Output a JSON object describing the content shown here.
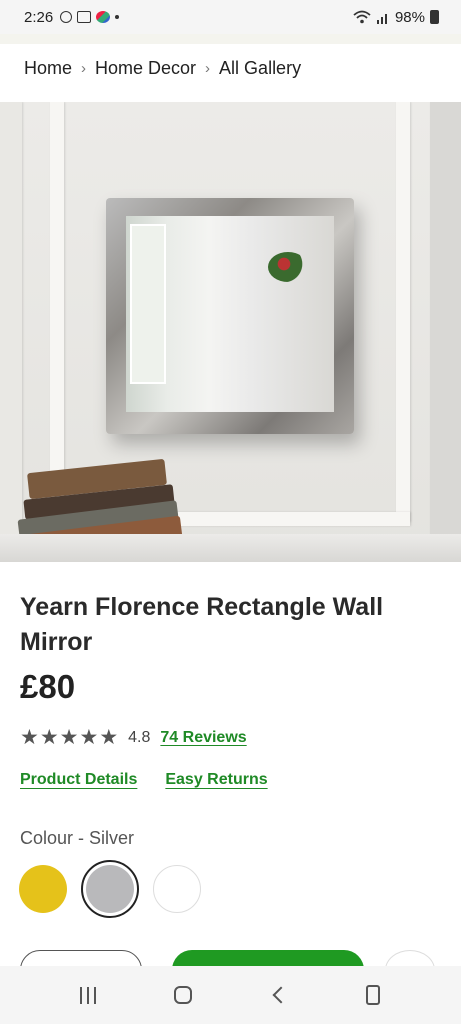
{
  "status_bar": {
    "time": "2:26",
    "battery": "98%",
    "icons": [
      "usb-debug-icon",
      "gallery-icon",
      "app-notification-icon",
      "wifi-icon",
      "signal-icon",
      "battery-icon"
    ]
  },
  "breadcrumb": {
    "items": [
      "Home",
      "Home Decor",
      "All Gallery"
    ],
    "separator": "›"
  },
  "product": {
    "title": "Yearn Florence Rectangle Wall Mirror",
    "price": "£80",
    "rating_value": "4.8",
    "rating_stars": 5,
    "reviews_label": "74 Reviews",
    "details_link": "Product Details",
    "returns_link": "Easy Returns",
    "colour_label": "Colour - Silver",
    "colours": [
      {
        "name": "Gold",
        "hex": "#e5c21a",
        "selected": false
      },
      {
        "name": "Silver",
        "hex": "#b9b9bb",
        "selected": true
      },
      {
        "name": "White",
        "hex": "#ffffff",
        "selected": false
      }
    ]
  },
  "theme": {
    "accent": "#1f9a22",
    "link": "#1f8a26"
  },
  "nav": {
    "icons": [
      "recents-icon",
      "home-icon",
      "back-icon",
      "assistant-icon"
    ]
  }
}
